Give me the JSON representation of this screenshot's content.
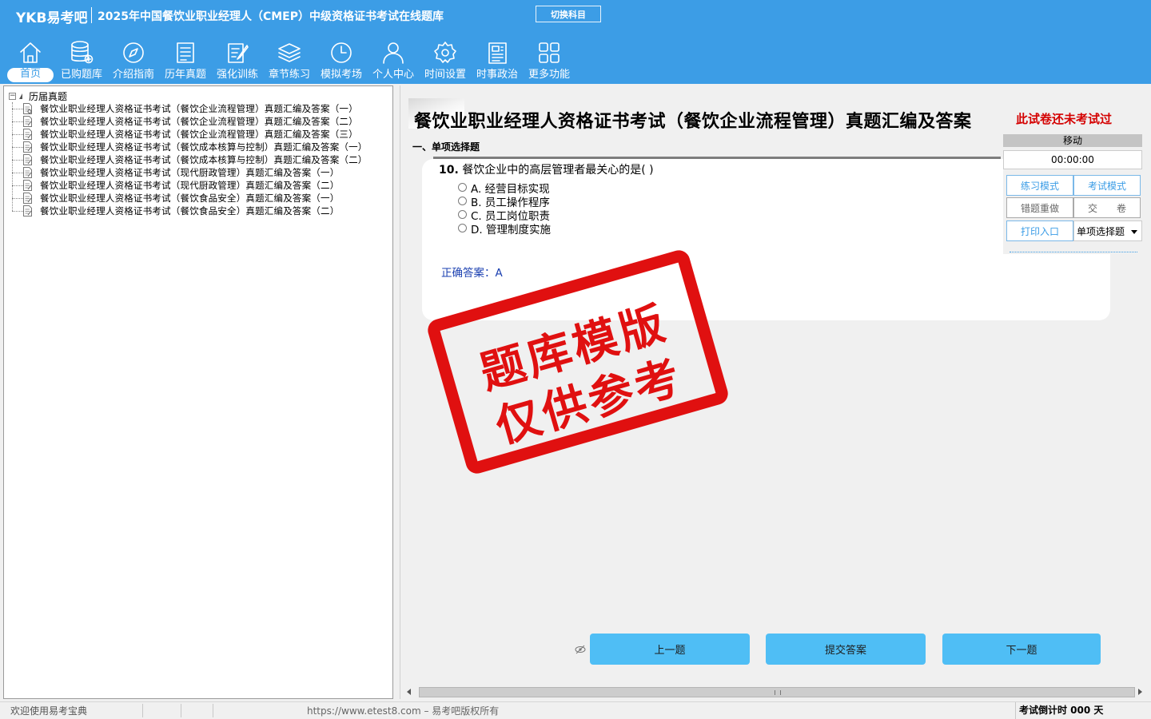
{
  "header": {
    "logo": "YKB易考吧",
    "title": "2025年中国餐饮业职业经理人（CMEP）中级资格证书考试在线题库",
    "switch_subject": "切换科目"
  },
  "nav": {
    "items": [
      {
        "label": "首页",
        "icon": "home-icon"
      },
      {
        "label": "已购题库",
        "icon": "database-icon"
      },
      {
        "label": "介绍指南",
        "icon": "compass-icon"
      },
      {
        "label": "历年真题",
        "icon": "list-icon"
      },
      {
        "label": "强化训练",
        "icon": "edit-icon"
      },
      {
        "label": "章节练习",
        "icon": "layers-icon"
      },
      {
        "label": "模拟考场",
        "icon": "clock-icon"
      },
      {
        "label": "个人中心",
        "icon": "user-icon"
      },
      {
        "label": "时间设置",
        "icon": "gear-icon"
      },
      {
        "label": "时事政治",
        "icon": "newspaper-icon"
      },
      {
        "label": "更多功能",
        "icon": "grid-icon"
      }
    ]
  },
  "tree": {
    "root": "历届真题",
    "items": [
      "餐饮业职业经理人资格证书考试（餐饮企业流程管理）真题汇编及答案（一）",
      "餐饮业职业经理人资格证书考试（餐饮企业流程管理）真题汇编及答案（二）",
      "餐饮业职业经理人资格证书考试（餐饮企业流程管理）真题汇编及答案（三）",
      "餐饮业职业经理人资格证书考试（餐饮成本核算与控制）真题汇编及答案（一）",
      "餐饮业职业经理人资格证书考试（餐饮成本核算与控制）真题汇编及答案（二）",
      "餐饮业职业经理人资格证书考试（现代厨政管理）真题汇编及答案（一）",
      "餐饮业职业经理人资格证书考试（现代厨政管理）真题汇编及答案（二）",
      "餐饮业职业经理人资格证书考试（餐饮食品安全）真题汇编及答案（一）",
      "餐饮业职业经理人资格证书考试（餐饮食品安全）真题汇编及答案（二）"
    ]
  },
  "main": {
    "doc_title": "餐饮业职业经理人资格证书考试（餐饮企业流程管理）真题汇编及答案",
    "status_note": "此试卷还未考试过",
    "section": "一、单项选择题",
    "question": {
      "number": "10.",
      "text": "餐饮企业中的高层管理者最关心的是( )",
      "options": [
        "A. 经营目标实现",
        "B. 员工操作程序",
        "C. 员工岗位职责",
        "D. 管理制度实施"
      ],
      "answer_label": "正确答案：",
      "answer_value": "A"
    },
    "stamp": {
      "line1": "题库模版",
      "line2": "仅供参考"
    },
    "prev": "上一题",
    "submit": "提交答案",
    "next": "下一题"
  },
  "panel": {
    "move": "移动",
    "timer": "00:00:00",
    "practice_mode": "练习模式",
    "exam_mode": "考试模式",
    "redo_wrong": "错题重做",
    "hand_in": "交　　卷",
    "print": "打印入口",
    "type_select": "单项选择题"
  },
  "status": {
    "welcome": "欢迎使用易考宝典",
    "copyright": "https://www.etest8.com – 易考吧版权所有",
    "countdown": "考试倒计时 000 天"
  },
  "colors": {
    "header_blue": "#3c9de6",
    "button_blue": "#4fbef5",
    "stamp_red": "#e01010",
    "answer_blue": "#1a3fb0"
  }
}
